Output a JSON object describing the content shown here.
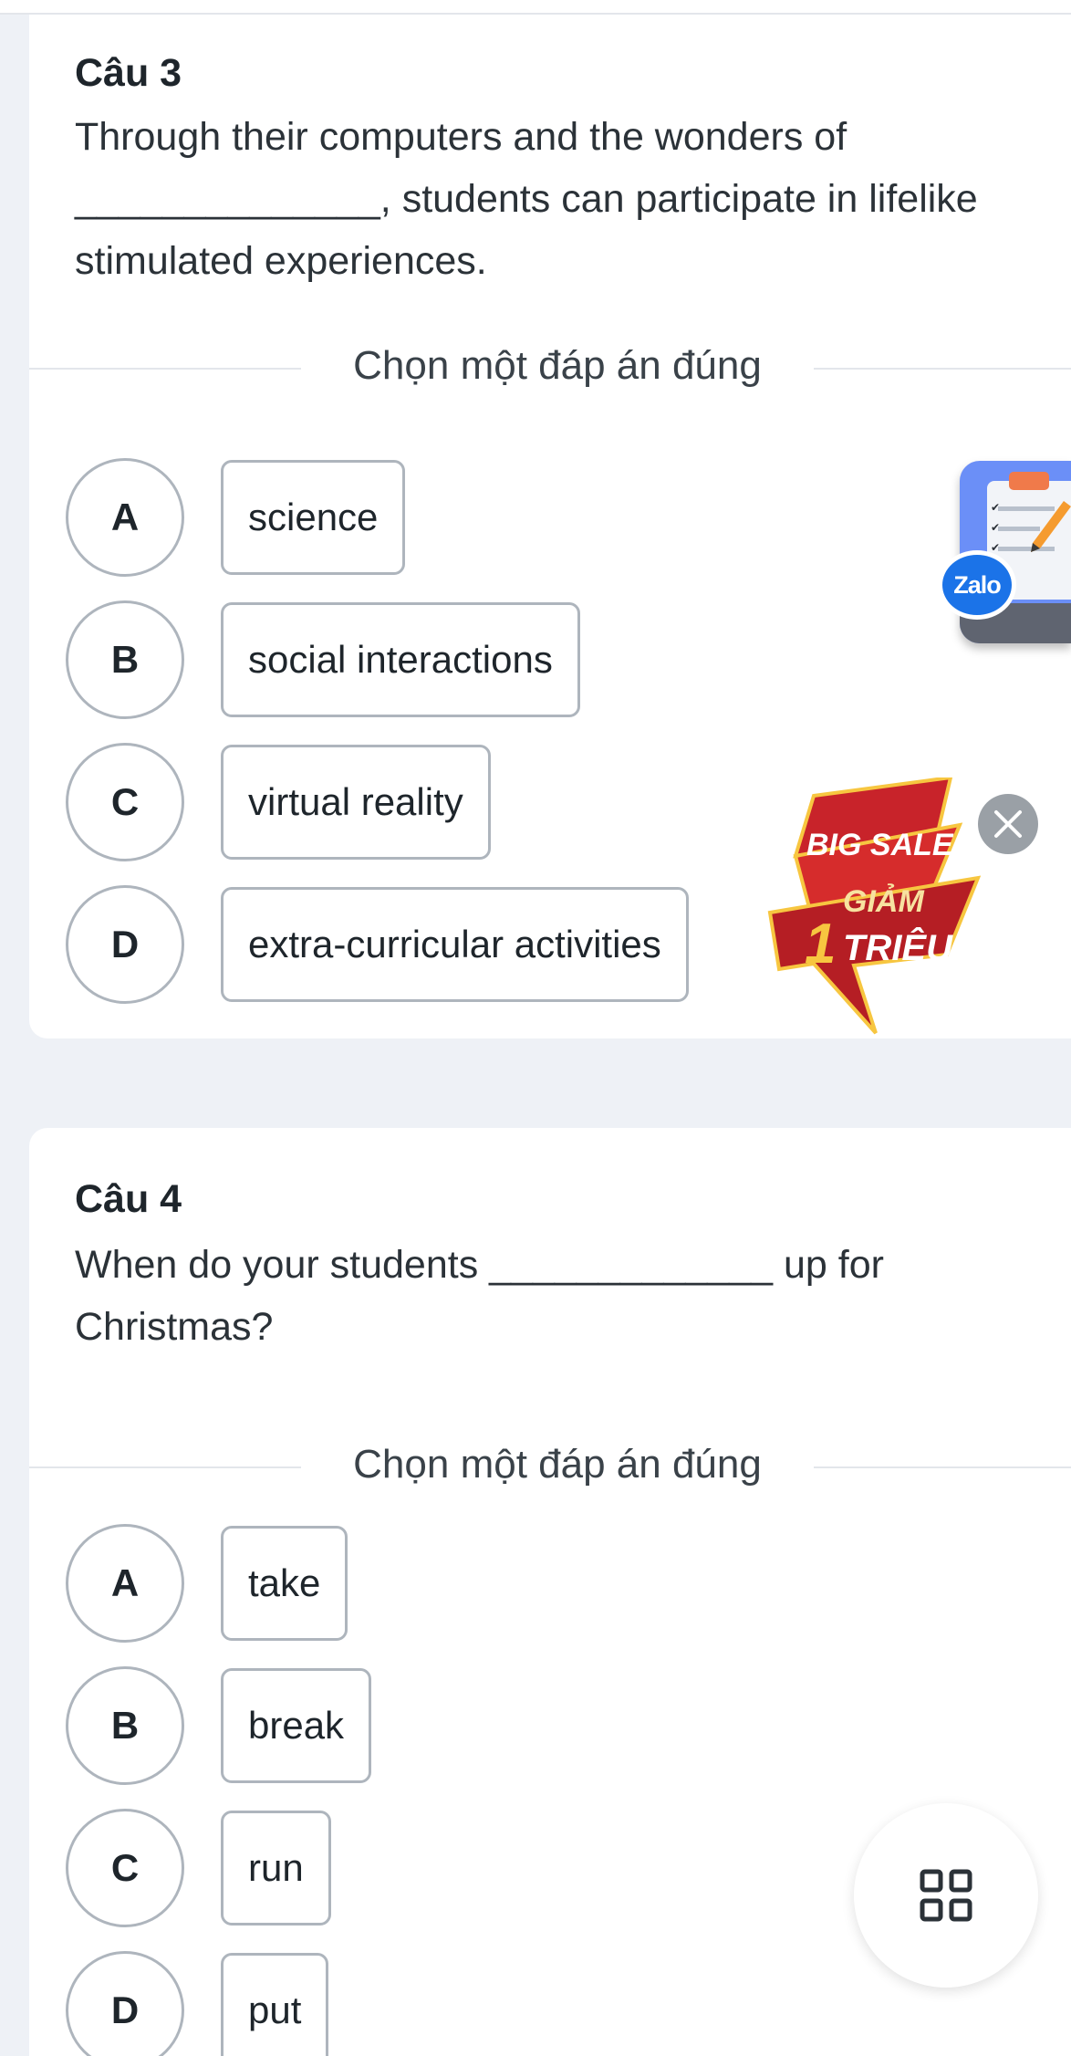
{
  "questions": [
    {
      "title": "Câu 3",
      "text_lines": [
        "Through their computers and the wonders of",
        "______________, students can participate in lifelike",
        "stimulated experiences."
      ],
      "instruction": "Chọn một đáp án đúng",
      "options": [
        {
          "letter": "A",
          "text": "science"
        },
        {
          "letter": "B",
          "text": "social interactions"
        },
        {
          "letter": "C",
          "text": "virtual reality"
        },
        {
          "letter": "D",
          "text": "extra-curricular activities"
        }
      ]
    },
    {
      "title": "Câu 4",
      "text_lines": [
        "When do your students _____________ up for",
        "Christmas?"
      ],
      "instruction": "Chọn một đáp án đúng",
      "options": [
        {
          "letter": "A",
          "text": "take"
        },
        {
          "letter": "B",
          "text": "break"
        },
        {
          "letter": "C",
          "text": "run"
        },
        {
          "letter": "D",
          "text": "put"
        }
      ]
    }
  ],
  "zalo_widget": {
    "badge_text": "Zalo",
    "icon": "clipboard-checklist-icon"
  },
  "sale_banner": {
    "line1": "BIG SALE",
    "line2": "GIẢM",
    "line3_number": "1",
    "line3_text": "TRIỆU",
    "close_icon": "close-icon"
  },
  "fab": {
    "icon": "grid-menu-icon"
  },
  "colors": {
    "page_bg": "#eef1f6",
    "card_bg": "#ffffff",
    "border": "#aeb5bd",
    "zalo_blue": "#1b73e8",
    "sale_red": "#c8232a",
    "sale_gold": "#f7c640"
  }
}
